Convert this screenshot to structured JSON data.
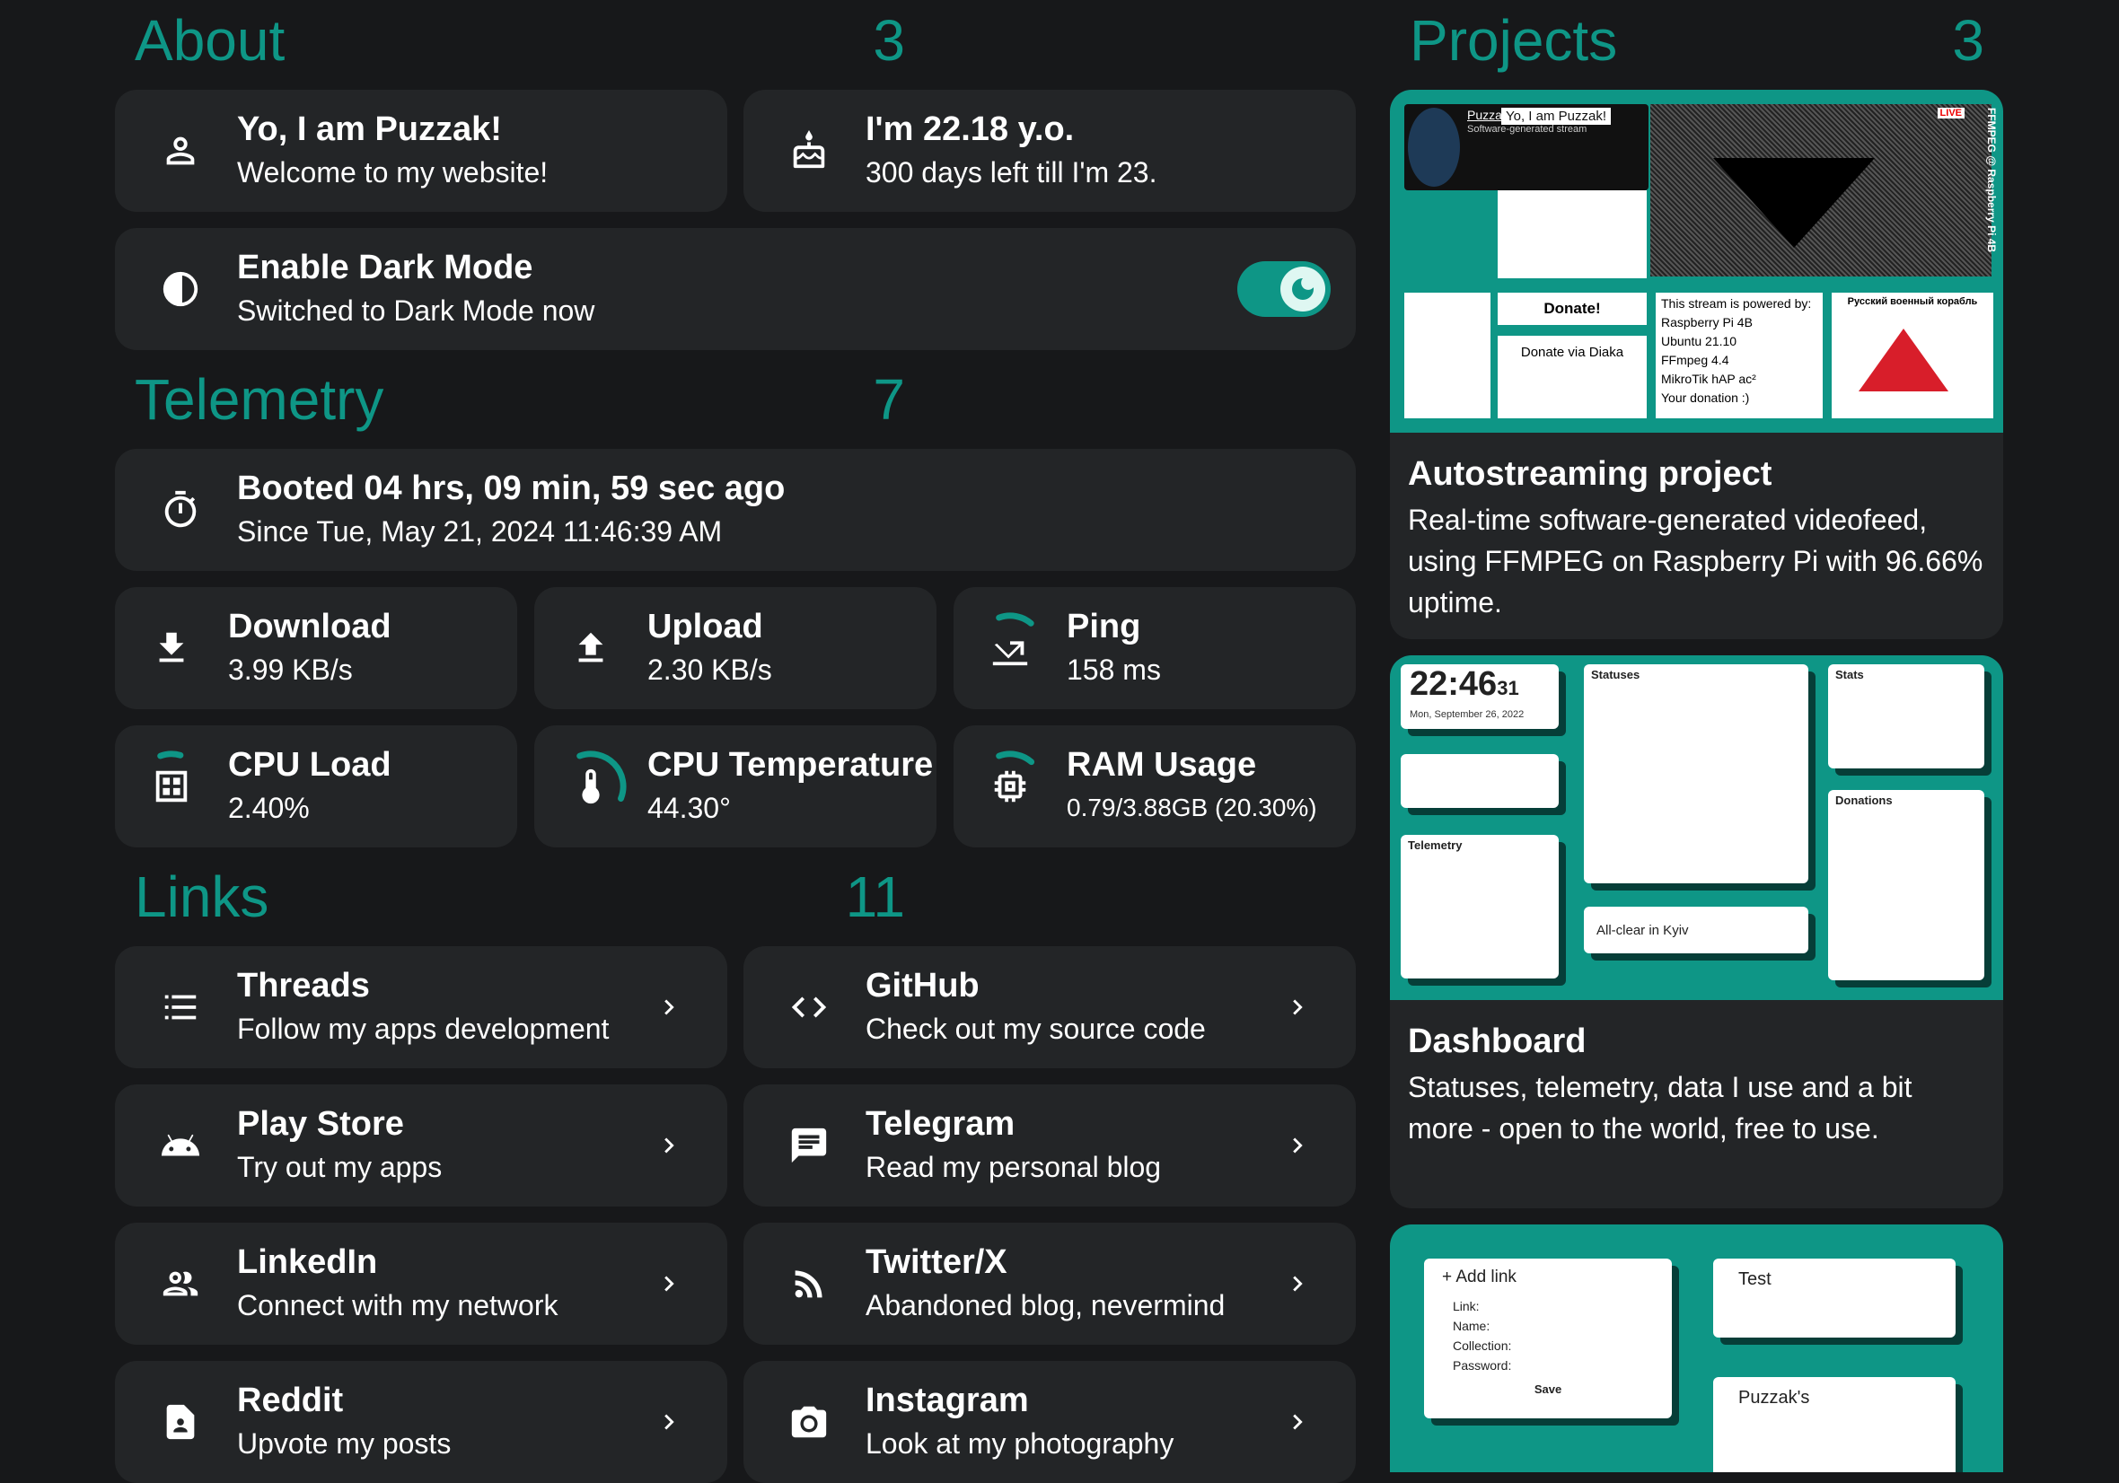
{
  "about": {
    "heading": "About",
    "count": "3",
    "intro": {
      "title": "Yo, I am Puzzak!",
      "subtitle": "Welcome to my website!",
      "icon": "person-icon"
    },
    "age": {
      "title": "I'm 22.18 y.o.",
      "subtitle": "300 days left till I'm 23.",
      "icon": "cake-icon"
    },
    "dark_mode": {
      "title": "Enable Dark Mode",
      "subtitle": "Switched to Dark Mode now",
      "icon": "contrast-icon",
      "enabled": true
    }
  },
  "telemetry": {
    "heading": "Telemetry",
    "count": "7",
    "boot": {
      "title": "Booted 04 hrs, 09 min, 59 sec ago",
      "subtitle": "Since Tue, May 21, 2024 11:46:39 AM"
    },
    "download": {
      "title": "Download",
      "value": "3.99 KB/s"
    },
    "upload": {
      "title": "Upload",
      "value": "2.30 KB/s"
    },
    "ping": {
      "title": "Ping",
      "value": "158 ms",
      "level": 0.2
    },
    "cpu_load": {
      "title": "CPU Load",
      "value": "2.40%",
      "level": 0.024
    },
    "cpu_temp": {
      "title": "CPU Temperature",
      "value": "44.30°",
      "level": 0.44
    },
    "ram": {
      "title": "RAM Usage",
      "value": "0.79/3.88GB (20.30%)",
      "level": 0.203
    }
  },
  "links": {
    "heading": "Links",
    "count": "11",
    "items": [
      {
        "title": "Threads",
        "subtitle": "Follow my apps development",
        "icon": "list-icon"
      },
      {
        "title": "GitHub",
        "subtitle": "Check out my source code",
        "icon": "code-icon"
      },
      {
        "title": "Play Store",
        "subtitle": "Try out my apps",
        "icon": "android-icon"
      },
      {
        "title": "Telegram",
        "subtitle": "Read my personal blog",
        "icon": "chat-icon"
      },
      {
        "title": "LinkedIn",
        "subtitle": "Connect with my network",
        "icon": "people-icon"
      },
      {
        "title": "Twitter/X",
        "subtitle": "Abandoned blog, nevermind",
        "icon": "rss-icon"
      },
      {
        "title": "Reddit",
        "subtitle": "Upvote my posts",
        "icon": "document-icon"
      },
      {
        "title": "Instagram",
        "subtitle": "Look at my photography",
        "icon": "camera-icon"
      }
    ]
  },
  "projects": {
    "heading": "Projects",
    "count": "3",
    "items": [
      {
        "title": "Autostreaming project",
        "description": "Real-time software-generated videofeed, using FFMPEG on Raspberry Pi with 96.66% uptime.",
        "preview": {
          "channel": "Puzzaks",
          "hello": "Yo, I am Puzzak!",
          "stream_sub": "Software-generated stream",
          "donate": "Donate!",
          "donate_via": "Donate via Diaka",
          "live": "LIVE",
          "powered": [
            "This stream is powered by:",
            "Raspberry Pi 4B",
            "Ubuntu 21.10",
            "FFmpeg 4.4",
            "MikroTik hAP ac²",
            "Your donation :)"
          ],
          "warship": "Русский военный корабль",
          "side": "FFMPEG @ Raspberry Pi 4B"
        }
      },
      {
        "title": "Dashboard",
        "description": "Statuses, telemetry, data I use and a bit more - open to the world, free to use.",
        "preview": {
          "clock": "22:46",
          "seconds": "31",
          "date": "Mon, September 26, 2022",
          "statuses": "Statuses",
          "stats": "Stats",
          "telemetry": "Telemetry",
          "donations": "Donations",
          "allclear": "All-clear in Kyiv"
        }
      },
      {
        "preview": {
          "add_link": "+ Add link",
          "fields": [
            "Link:",
            "Name:",
            "Collection:",
            "Password:"
          ],
          "save": "Save",
          "test": "Test",
          "puzzaks": "Puzzak's"
        }
      }
    ]
  },
  "colors": {
    "accent": "#0e9686",
    "background": "#17181a",
    "card": "#232527"
  }
}
